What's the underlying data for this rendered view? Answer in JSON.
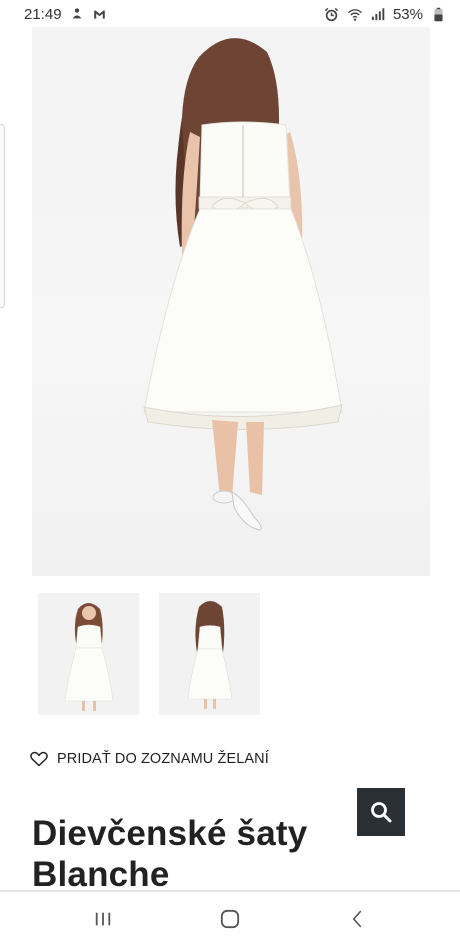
{
  "status_bar": {
    "time": "21:49",
    "left_icons": [
      "notification-icon",
      "gmail-icon"
    ],
    "battery": "53%",
    "right_icons": [
      "alarm-icon",
      "wifi-icon",
      "signal-icon",
      "battery-icon"
    ]
  },
  "gallery": {
    "main_image_alt": "white dress back view",
    "thumbnails": [
      "front-view",
      "back-view"
    ]
  },
  "wishlist": {
    "label": "PRIDAŤ DO ZOZNAMU ŽELANÍ",
    "icon": "heart-icon"
  },
  "product": {
    "title_line1": "Dievčenské šaty",
    "title_line2": "Blanche"
  },
  "search_button": {
    "icon": "search-icon",
    "color": "#2b3036"
  },
  "nav_bar": {
    "buttons": [
      "recents-icon",
      "home-icon",
      "back-icon"
    ]
  }
}
